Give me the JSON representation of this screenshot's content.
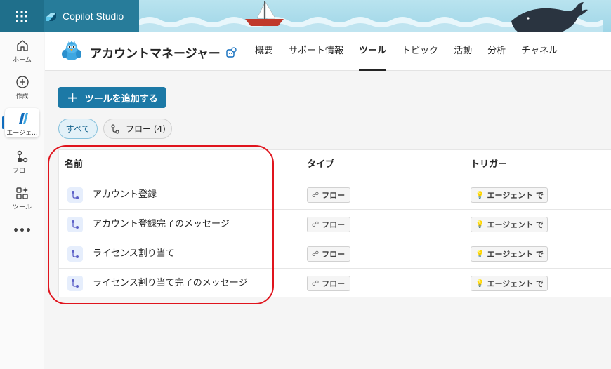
{
  "brand": {
    "name": "Copilot Studio"
  },
  "rail": {
    "items": [
      {
        "label": "ホーム",
        "icon": "home-icon"
      },
      {
        "label": "作成",
        "icon": "create-icon"
      },
      {
        "label": "エージェ...",
        "icon": "agent-icon"
      },
      {
        "label": "フロー",
        "icon": "flow-icon"
      },
      {
        "label": "ツール",
        "icon": "tools-icon"
      }
    ],
    "more": "•••"
  },
  "header": {
    "agent_name": "アカウントマネージャー",
    "tabs": [
      "概要",
      "サポート情報",
      "ツール",
      "トピック",
      "活動",
      "分析",
      "チャネル"
    ],
    "active_tab": "ツール"
  },
  "toolbar": {
    "add_tool_label": "ツールを追加する"
  },
  "filters": {
    "all_label": "すべて",
    "flow_label": "フロー (4)"
  },
  "table": {
    "headers": {
      "name": "名前",
      "type": "タイプ",
      "trigger": "トリガー"
    },
    "rows": [
      {
        "name": "アカウント登録",
        "type": "フロー",
        "trigger": "エージェント で"
      },
      {
        "name": "アカウント登録完了のメッセージ",
        "type": "フロー",
        "trigger": "エージェント で"
      },
      {
        "name": "ライセンス割り当て",
        "type": "フロー",
        "trigger": "エージェント で"
      },
      {
        "name": "ライセンス割り当て完了のメッセージ",
        "type": "フロー",
        "trigger": "エージェント で"
      }
    ]
  },
  "colors": {
    "accent": "#1c79a6",
    "highlight": "#e0141d",
    "brand_bg": "#277c9a"
  }
}
